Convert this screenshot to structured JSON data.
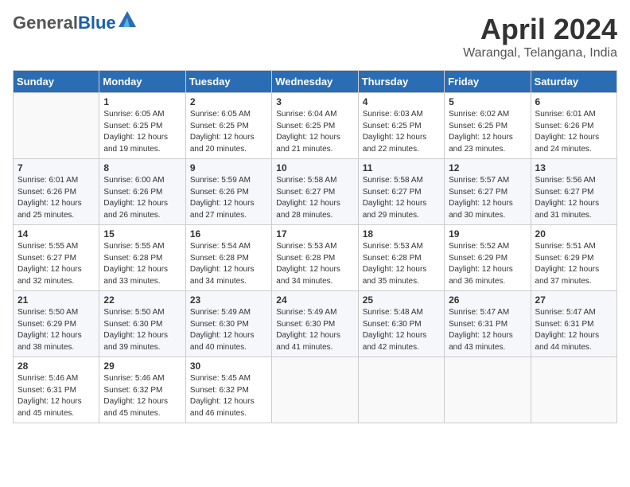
{
  "header": {
    "logo_general": "General",
    "logo_blue": "Blue",
    "month_title": "April 2024",
    "subtitle": "Warangal, Telangana, India"
  },
  "columns": [
    "Sunday",
    "Monday",
    "Tuesday",
    "Wednesday",
    "Thursday",
    "Friday",
    "Saturday"
  ],
  "weeks": [
    [
      {
        "day": "",
        "info": ""
      },
      {
        "day": "1",
        "info": "Sunrise: 6:05 AM\nSunset: 6:25 PM\nDaylight: 12 hours\nand 19 minutes."
      },
      {
        "day": "2",
        "info": "Sunrise: 6:05 AM\nSunset: 6:25 PM\nDaylight: 12 hours\nand 20 minutes."
      },
      {
        "day": "3",
        "info": "Sunrise: 6:04 AM\nSunset: 6:25 PM\nDaylight: 12 hours\nand 21 minutes."
      },
      {
        "day": "4",
        "info": "Sunrise: 6:03 AM\nSunset: 6:25 PM\nDaylight: 12 hours\nand 22 minutes."
      },
      {
        "day": "5",
        "info": "Sunrise: 6:02 AM\nSunset: 6:25 PM\nDaylight: 12 hours\nand 23 minutes."
      },
      {
        "day": "6",
        "info": "Sunrise: 6:01 AM\nSunset: 6:26 PM\nDaylight: 12 hours\nand 24 minutes."
      }
    ],
    [
      {
        "day": "7",
        "info": "Sunrise: 6:01 AM\nSunset: 6:26 PM\nDaylight: 12 hours\nand 25 minutes."
      },
      {
        "day": "8",
        "info": "Sunrise: 6:00 AM\nSunset: 6:26 PM\nDaylight: 12 hours\nand 26 minutes."
      },
      {
        "day": "9",
        "info": "Sunrise: 5:59 AM\nSunset: 6:26 PM\nDaylight: 12 hours\nand 27 minutes."
      },
      {
        "day": "10",
        "info": "Sunrise: 5:58 AM\nSunset: 6:27 PM\nDaylight: 12 hours\nand 28 minutes."
      },
      {
        "day": "11",
        "info": "Sunrise: 5:58 AM\nSunset: 6:27 PM\nDaylight: 12 hours\nand 29 minutes."
      },
      {
        "day": "12",
        "info": "Sunrise: 5:57 AM\nSunset: 6:27 PM\nDaylight: 12 hours\nand 30 minutes."
      },
      {
        "day": "13",
        "info": "Sunrise: 5:56 AM\nSunset: 6:27 PM\nDaylight: 12 hours\nand 31 minutes."
      }
    ],
    [
      {
        "day": "14",
        "info": "Sunrise: 5:55 AM\nSunset: 6:27 PM\nDaylight: 12 hours\nand 32 minutes."
      },
      {
        "day": "15",
        "info": "Sunrise: 5:55 AM\nSunset: 6:28 PM\nDaylight: 12 hours\nand 33 minutes."
      },
      {
        "day": "16",
        "info": "Sunrise: 5:54 AM\nSunset: 6:28 PM\nDaylight: 12 hours\nand 34 minutes."
      },
      {
        "day": "17",
        "info": "Sunrise: 5:53 AM\nSunset: 6:28 PM\nDaylight: 12 hours\nand 34 minutes."
      },
      {
        "day": "18",
        "info": "Sunrise: 5:53 AM\nSunset: 6:28 PM\nDaylight: 12 hours\nand 35 minutes."
      },
      {
        "day": "19",
        "info": "Sunrise: 5:52 AM\nSunset: 6:29 PM\nDaylight: 12 hours\nand 36 minutes."
      },
      {
        "day": "20",
        "info": "Sunrise: 5:51 AM\nSunset: 6:29 PM\nDaylight: 12 hours\nand 37 minutes."
      }
    ],
    [
      {
        "day": "21",
        "info": "Sunrise: 5:50 AM\nSunset: 6:29 PM\nDaylight: 12 hours\nand 38 minutes."
      },
      {
        "day": "22",
        "info": "Sunrise: 5:50 AM\nSunset: 6:30 PM\nDaylight: 12 hours\nand 39 minutes."
      },
      {
        "day": "23",
        "info": "Sunrise: 5:49 AM\nSunset: 6:30 PM\nDaylight: 12 hours\nand 40 minutes."
      },
      {
        "day": "24",
        "info": "Sunrise: 5:49 AM\nSunset: 6:30 PM\nDaylight: 12 hours\nand 41 minutes."
      },
      {
        "day": "25",
        "info": "Sunrise: 5:48 AM\nSunset: 6:30 PM\nDaylight: 12 hours\nand 42 minutes."
      },
      {
        "day": "26",
        "info": "Sunrise: 5:47 AM\nSunset: 6:31 PM\nDaylight: 12 hours\nand 43 minutes."
      },
      {
        "day": "27",
        "info": "Sunrise: 5:47 AM\nSunset: 6:31 PM\nDaylight: 12 hours\nand 44 minutes."
      }
    ],
    [
      {
        "day": "28",
        "info": "Sunrise: 5:46 AM\nSunset: 6:31 PM\nDaylight: 12 hours\nand 45 minutes."
      },
      {
        "day": "29",
        "info": "Sunrise: 5:46 AM\nSunset: 6:32 PM\nDaylight: 12 hours\nand 45 minutes."
      },
      {
        "day": "30",
        "info": "Sunrise: 5:45 AM\nSunset: 6:32 PM\nDaylight: 12 hours\nand 46 minutes."
      },
      {
        "day": "",
        "info": ""
      },
      {
        "day": "",
        "info": ""
      },
      {
        "day": "",
        "info": ""
      },
      {
        "day": "",
        "info": ""
      }
    ]
  ]
}
